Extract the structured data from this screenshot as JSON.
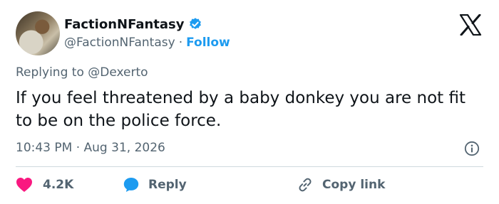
{
  "author": {
    "display_name": "FactionNFantasy",
    "handle": "@FactionNFantasy",
    "separator": "·",
    "follow_label": "Follow"
  },
  "reply_context": "Replying to @Dexerto",
  "tweet_text": "If you feel threatened by a baby donkey you are not fit to be on the police force.",
  "timestamp": "10:43 PM · Aug 31, 2026",
  "actions": {
    "like_count": "4.2K",
    "reply_label": "Reply",
    "copy_link_label": "Copy link"
  },
  "colors": {
    "accent": "#1d9bf0",
    "like": "#f91880",
    "text": "#0f1419",
    "muted": "#536471"
  },
  "icons": [
    "avatar-image",
    "verified-badge-icon",
    "x-logo-icon",
    "info-icon",
    "heart-icon",
    "reply-bubble-icon",
    "link-icon"
  ]
}
